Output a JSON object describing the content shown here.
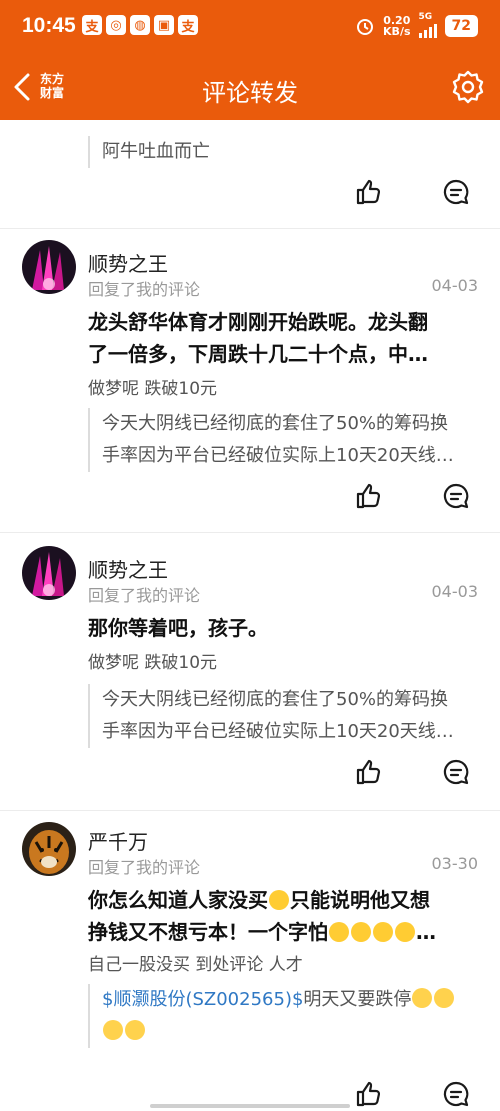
{
  "status_bar": {
    "time": "10:45",
    "apps": [
      "支",
      "◎",
      "◍",
      "▣",
      "支"
    ],
    "speed_top": "0.20",
    "speed_unit": "KB/s",
    "network": "5G",
    "battery": "72"
  },
  "header": {
    "brand_line1": "东方",
    "brand_line2": "财富",
    "title": "评论转发"
  },
  "top_fragment": {
    "quote": "阿牛吐血而亡"
  },
  "posts": [
    {
      "username": "顺势之王",
      "subtitle": "回复了我的评论",
      "date": "04-03",
      "content_line1": "龙头舒华体育才刚刚开始跌呢。龙头翻",
      "content_line2": "了一倍多，下周跌十几二十个点，中…",
      "orig": "做梦呢  跌破10元",
      "quote_line1": "今天大阴线已经彻底的套住了50%的筹码换",
      "quote_line2": "手率因为平台已经破位实际上10天20天线…"
    },
    {
      "username": "顺势之王",
      "subtitle": "回复了我的评论",
      "date": "04-03",
      "content_line1": "那你等着吧，孩子。",
      "orig": "做梦呢  跌破10元",
      "quote_line1": "今天大阴线已经彻底的套住了50%的筹码换",
      "quote_line2": "手率因为平台已经破位实际上10天20天线…"
    },
    {
      "username": "严千万",
      "subtitle": "回复了我的评论",
      "date": "03-30",
      "content_line1a": "你怎么知道人家没买",
      "content_line1b": "只能说明他又想",
      "content_line2": "挣钱又不想亏本！一个字怕",
      "content_line2_tail": "…",
      "orig": "自己一股没买  到处评论   人才",
      "quote_link": "$顺灏股份(SZ002565)$",
      "quote_text": "明天又要跌停"
    }
  ],
  "colors": {
    "brand": "#ea5b0c",
    "link": "#2f78c4"
  },
  "icons": {
    "like": "thumbs-up-icon",
    "comment": "comment-icon",
    "settings": "gear-icon",
    "back": "back-arrow-icon"
  }
}
